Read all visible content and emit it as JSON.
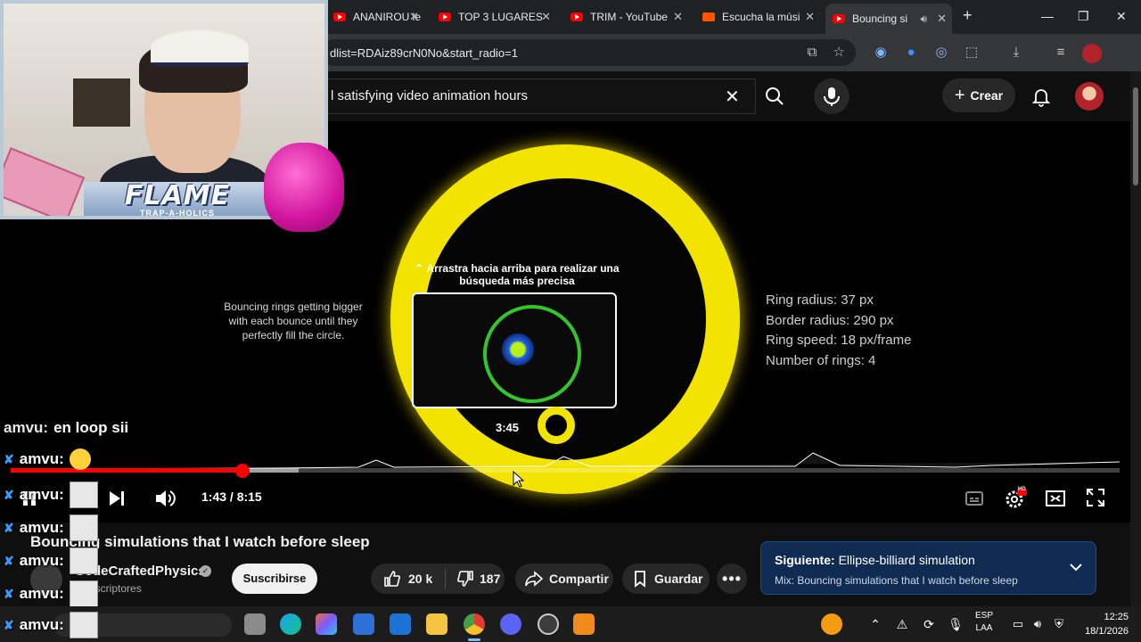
{
  "browser": {
    "tabs": [
      {
        "label": "ANANIROU le",
        "active": false,
        "favicon": "youtube"
      },
      {
        "label": "TOP 3 LUGARES",
        "active": false,
        "favicon": "youtube"
      },
      {
        "label": "TRIM - YouTube",
        "active": false,
        "favicon": "youtube"
      },
      {
        "label": "Escucha la músi",
        "active": false,
        "favicon": "soundcloud"
      },
      {
        "label": "Bouncing si",
        "active": true,
        "favicon": "youtube"
      }
    ],
    "new_tab": "+",
    "url": "dlist=RDAiz89crN0No&start_radio=1"
  },
  "youtube": {
    "search_value": "l satisfying video animation hours",
    "create_label": "Crear"
  },
  "video": {
    "description_left": "Bouncing rings getting bigger with each bounce until they perfectly fill the circle.",
    "params": [
      "Ring radius: 37 px",
      "Border radius: 290 px",
      "Ring speed: 18 px/frame",
      "Number of rings: 4"
    ],
    "drag_hint": "⌃ Arrastra hacia arriba para realizar una búsqueda más precisa",
    "preview_time": "3:45",
    "progress_fraction": 0.209,
    "buffered_fraction": 0.26,
    "time_display": "1:43 / 8:15",
    "settings_badge": "HD"
  },
  "below": {
    "title": "Bouncing simulations that I watch before sleep",
    "channel_name": "CodeCraftedPhysics",
    "channel_subs": "3 suscriptores",
    "subscribe_label": "Suscribirse",
    "likes": "20 k",
    "dislikes": "187",
    "share_label": "Compartir",
    "save_label": "Guardar",
    "next_prefix": "Siguiente:",
    "next_title": "Ellipse-billiard simulation",
    "next_sub": "Mix: Bouncing simulations that I watch before sleep"
  },
  "stream": {
    "banner_title": "FLAME",
    "banner_sub": "TRAP-A-HOLICS",
    "chat": [
      {
        "user": "amvu:",
        "text": "en loop sii",
        "extra": "none"
      },
      {
        "user": "amvu:",
        "text": "",
        "extra": "emoji"
      },
      {
        "user": "amvu:",
        "text": "",
        "extra": "emote"
      },
      {
        "user": "amvu:",
        "text": "",
        "extra": "emote"
      },
      {
        "user": "amvu:",
        "text": "",
        "extra": "emote"
      },
      {
        "user": "amvu:",
        "text": "",
        "extra": "emote"
      },
      {
        "user": "amvu:",
        "text": "",
        "extra": "emote"
      }
    ]
  },
  "taskbar": {
    "lang_1": "ESP",
    "lang_2": "LAA",
    "time": "12:25",
    "date": "18/1/2026"
  }
}
